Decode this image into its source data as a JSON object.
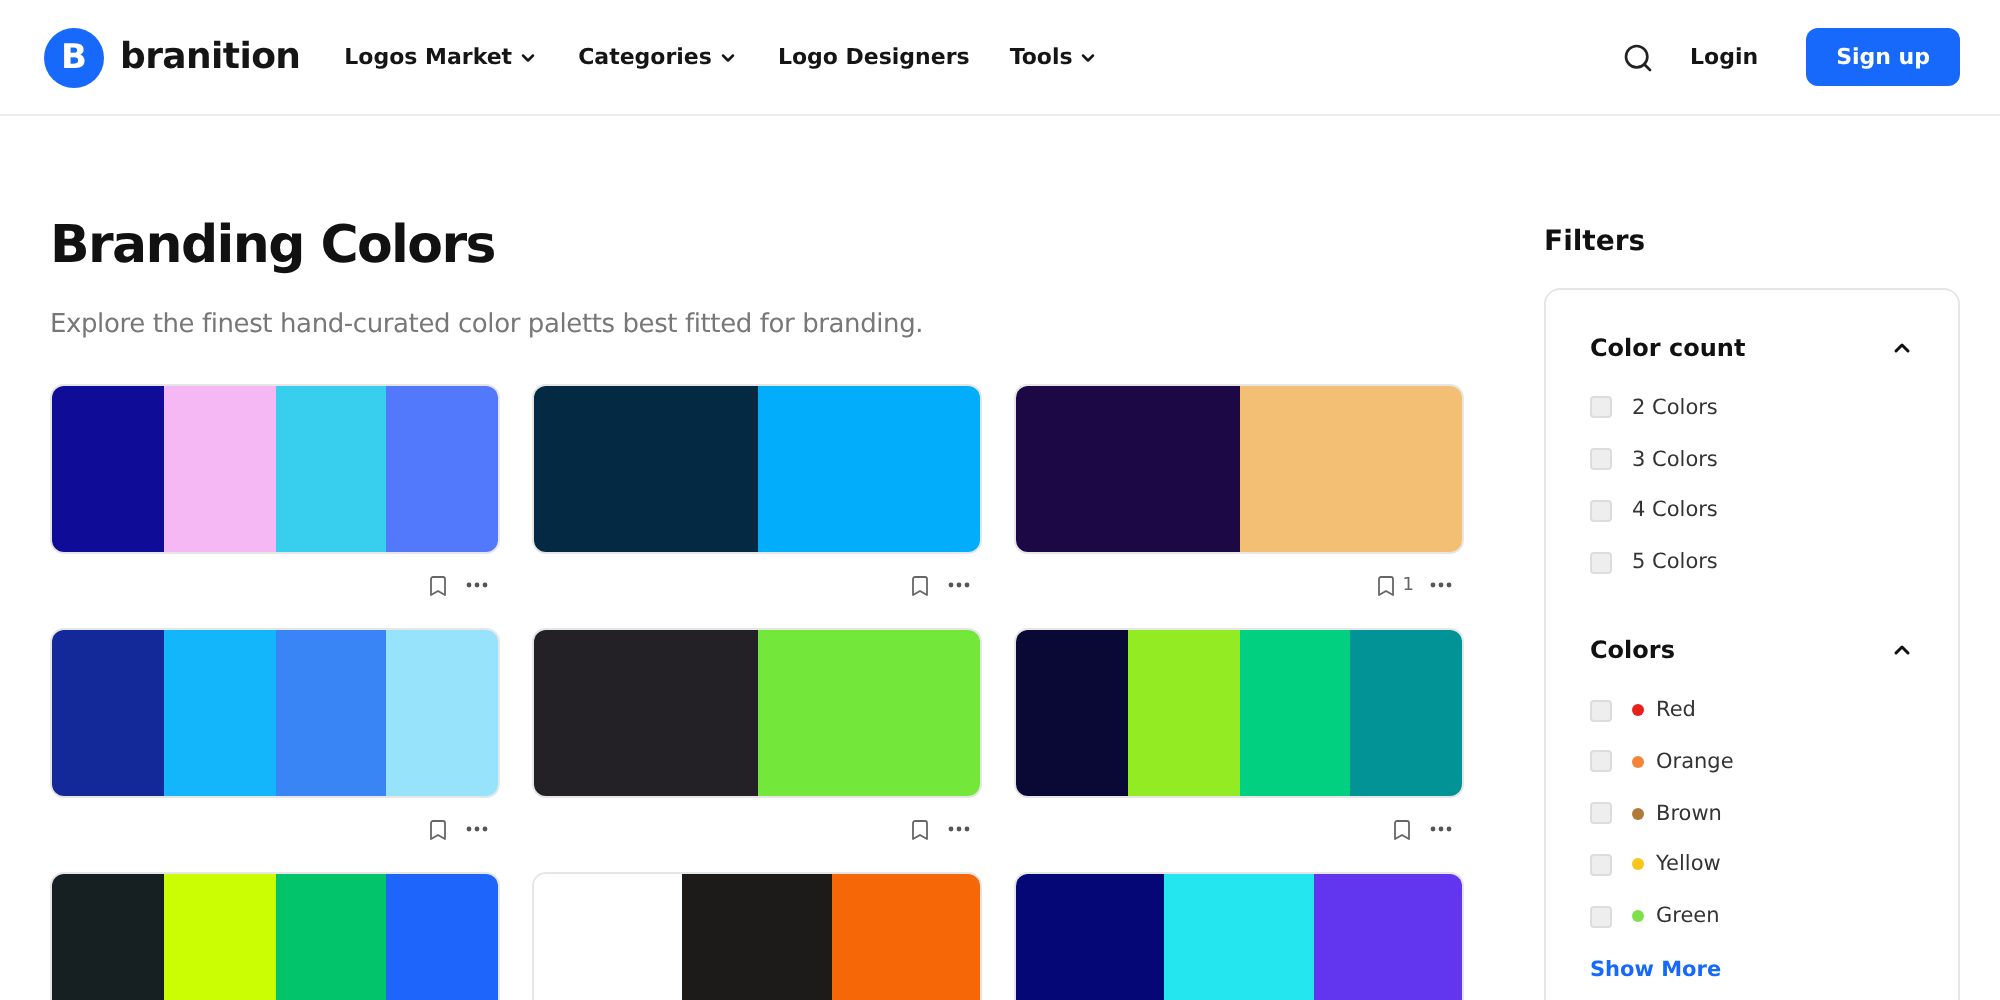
{
  "header": {
    "logo": {
      "letter": "B",
      "name": "branition"
    },
    "nav": [
      {
        "label": "Logos Market",
        "has_menu": true
      },
      {
        "label": "Categories",
        "has_menu": true
      },
      {
        "label": "Logo Designers",
        "has_menu": false
      },
      {
        "label": "Tools",
        "has_menu": true
      }
    ],
    "login": "Login",
    "signup": "Sign up"
  },
  "title": "Branding Colors",
  "subtitle": "Explore the finest hand-curated color paletts best fitted for branding.",
  "palettes": [
    {
      "swatches": [
        {
          "color": "#0f0d98"
        },
        {
          "color": "#f5b8f5"
        },
        {
          "color": "#38cfef"
        },
        {
          "color": "#5278fb"
        }
      ]
    },
    {
      "swatches": [
        {
          "color": "#042943"
        },
        {
          "color": "#02aefc"
        }
      ]
    },
    {
      "swatches": [
        {
          "color": "#1b0845"
        },
        {
          "color": "#f2bf75"
        }
      ],
      "saves": "1"
    },
    {
      "swatches": [
        {
          "color": "#13299a"
        },
        {
          "color": "#13b6fb"
        },
        {
          "color": "#3a85f6"
        },
        {
          "color": "#97e3fb"
        }
      ]
    },
    {
      "swatches": [
        {
          "color": "#232125"
        },
        {
          "color": "#73e83b"
        }
      ]
    },
    {
      "swatches": [
        {
          "color": "#0a0835"
        },
        {
          "color": "#93ec23"
        },
        {
          "color": "#02d081"
        },
        {
          "color": "#029396"
        }
      ]
    },
    {
      "swatches": [
        {
          "color": "#161f22"
        },
        {
          "color": "#cbfe03"
        },
        {
          "color": "#01c46b"
        },
        {
          "color": "#1e66fb"
        }
      ]
    },
    {
      "swatches": [
        {
          "color": "#ffffff"
        },
        {
          "color": "#1d1b1a"
        },
        {
          "color": "#f66707"
        }
      ]
    },
    {
      "swatches": [
        {
          "color": "#040775"
        },
        {
          "color": "#23e6ee"
        },
        {
          "color": "#6236ef"
        }
      ]
    }
  ],
  "filters": {
    "title": "Filters",
    "sections": [
      {
        "title": "Color count",
        "expanded": true,
        "options": [
          {
            "label": "2 Colors",
            "checked": false
          },
          {
            "label": "3 Colors",
            "checked": false
          },
          {
            "label": "4 Colors",
            "checked": false
          },
          {
            "label": "5 Colors",
            "checked": false
          }
        ]
      },
      {
        "title": "Colors",
        "expanded": true,
        "options": [
          {
            "label": "Red",
            "checked": false,
            "color": "#e8201a"
          },
          {
            "label": "Orange",
            "checked": false,
            "color": "#f5843a"
          },
          {
            "label": "Brown",
            "checked": false,
            "color": "#b07a3a"
          },
          {
            "label": "Yellow",
            "checked": false,
            "color": "#f7c51c"
          },
          {
            "label": "Green",
            "checked": false,
            "color": "#7de04a"
          }
        ]
      }
    ],
    "show_more": "Show More"
  }
}
